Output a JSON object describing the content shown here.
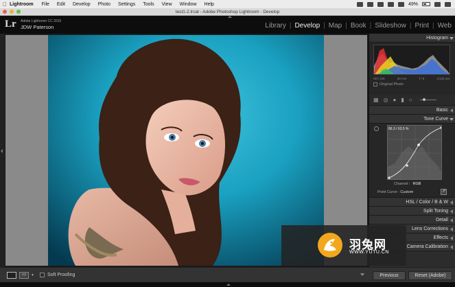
{
  "menubar": {
    "app": "Lightroom",
    "items": [
      "File",
      "Edit",
      "Develop",
      "Photo",
      "Settings",
      "Tools",
      "View",
      "Window",
      "Help"
    ],
    "battery": "49%"
  },
  "window": {
    "title": "test1-2.lrcat - Adobe Photoshop Lightroom - Develop"
  },
  "identity": {
    "logo": "Lr",
    "line1": "Adobe Lightroom CC 2015",
    "line2": "JDW Paterson"
  },
  "modules": [
    "Library",
    "Develop",
    "Map",
    "Book",
    "Slideshow",
    "Print",
    "Web"
  ],
  "active_module": "Develop",
  "right_panel": {
    "histogram_label": "Histogram",
    "histo_info": [
      "ISO 100",
      "50 mm",
      "f / 8",
      "1/125 sec"
    ],
    "original_photo": "Original Photo",
    "basic_label": "Basic",
    "tone_curve_label": "Tone Curve",
    "curve_readout": "86.3 / 63.5 %",
    "channel_label": "Channel :",
    "channel_value": "RGB",
    "point_curve_label": "Point Curve :",
    "point_curve_value": "Custom",
    "sections": [
      "HSL / Color / B & W",
      "Split Toning",
      "Detail",
      "Lens Corrections",
      "Effects",
      "Camera Calibration"
    ]
  },
  "toolbar": {
    "soft_proofing": "Soft Proofing"
  },
  "buttons": {
    "previous": "Previous",
    "reset": "Reset (Adobe)"
  },
  "watermark": {
    "cn": "羽兔网",
    "url": "WWW.YUTU.CN"
  },
  "colors": {
    "background_teal": "#1aa0c0",
    "accent_orange": "#f2a81d",
    "panel_bg": "#2c2c2c"
  }
}
